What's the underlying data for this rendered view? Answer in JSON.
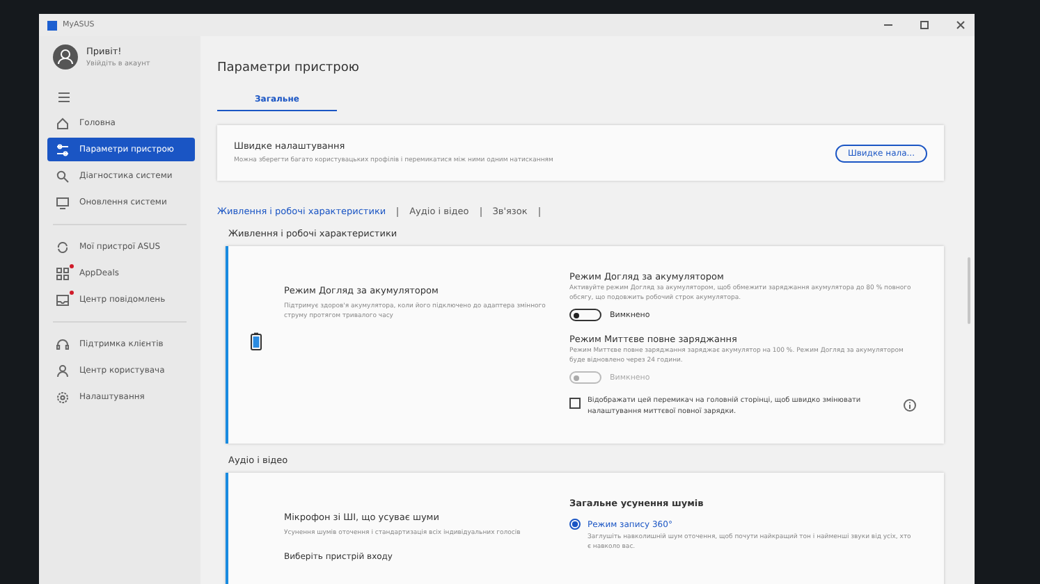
{
  "window": {
    "title": "MyASUS"
  },
  "account": {
    "greeting": "Привіт!",
    "subtitle": "Увійдіть в акаунт"
  },
  "sidebar": {
    "groups": [
      [
        {
          "kind": "home",
          "label": "Головна",
          "selected": false,
          "notification": false
        },
        {
          "kind": "device",
          "label": "Параметри пристрою",
          "selected": true,
          "notification": false
        },
        {
          "kind": "diagnostics",
          "label": "Діагностика системи",
          "selected": false,
          "notification": false
        },
        {
          "kind": "update",
          "label": "Оновлення системи",
          "selected": false,
          "notification": false
        }
      ],
      [
        {
          "kind": "devices",
          "label": "Мої пристрої ASUS",
          "selected": false,
          "notification": false
        },
        {
          "kind": "deals",
          "label": "AppDeals",
          "selected": false,
          "notification": true
        },
        {
          "kind": "notifications",
          "label": "Центр повідомлень",
          "selected": false,
          "notification": true
        }
      ],
      [
        {
          "kind": "support",
          "label": "Підтримка клієнтів",
          "selected": false,
          "notification": false
        },
        {
          "kind": "user",
          "label": "Центр користувача",
          "selected": false,
          "notification": false
        },
        {
          "kind": "settings",
          "label": "Налаштування",
          "selected": false,
          "notification": false
        }
      ]
    ]
  },
  "page": {
    "title": "Параметри пристрою"
  },
  "tabs": [
    {
      "label": "Загальне",
      "selected": true
    }
  ],
  "quick_settings": {
    "title": "Швидке налаштування",
    "description": "Можна зберегти багато користувацьких профілів і перемикатися між ними одним натисканням",
    "button": "Швидке нала..."
  },
  "anchors": [
    {
      "label": "Живлення і робочі характеристики",
      "selected": true
    },
    {
      "label": "Аудіо і відео",
      "selected": false
    },
    {
      "label": "Зв'язок",
      "selected": false
    }
  ],
  "sections": [
    {
      "kind": "power",
      "title": "Живлення і робочі характеристики",
      "feature": {
        "title": "Режим Догляд за акумулятором",
        "description": "Підтримує здоров'я акумулятора, коли його підключено до адаптера змінного струму протягом тривалого часу"
      },
      "options": [
        {
          "kind": "toggle",
          "title": "Режим Догляд за акумулятором",
          "description": "Активуйте режим Догляд за акумулятором, щоб обмежити заряджання акумулятора до 80 % повного обсягу, що подовжить робочий строк акумулятора.",
          "label": "Вимкнено",
          "on": false,
          "disabled": false
        },
        {
          "kind": "toggle",
          "title": "Режим Миттєве повне заряджання",
          "description": "Режим Миттєве повне заряджання заряджає акумулятор на 100 %. Режим Догляд за акумулятором буде відновлено через 24 години.",
          "label": "Вимкнено",
          "on": false,
          "disabled": true
        },
        {
          "kind": "checkbox",
          "label": "Відображати цей перемикач на головній сторінці, щоб швидко змінювати налаштування миттєвої повної зарядки.",
          "checked": false
        }
      ]
    },
    {
      "kind": "audio",
      "title": "Аудіо і відео",
      "feature": {
        "title": "Мікрофон зі ШІ, що усуває шуми",
        "description": "Усунення шумів оточення і стандартизація всіх індивідуальних голосів",
        "extra": "Виберіть пристрій входу"
      },
      "options": [
        {
          "kind": "heading",
          "title": "Загальне усунення шумів"
        },
        {
          "kind": "radio",
          "label": "Режим запису 360°",
          "selected": true,
          "description": "Заглушіть навколишній шум оточення, щоб почути найкращий тон і найменші звуки від усіх, хто є навколо вас."
        }
      ]
    }
  ]
}
